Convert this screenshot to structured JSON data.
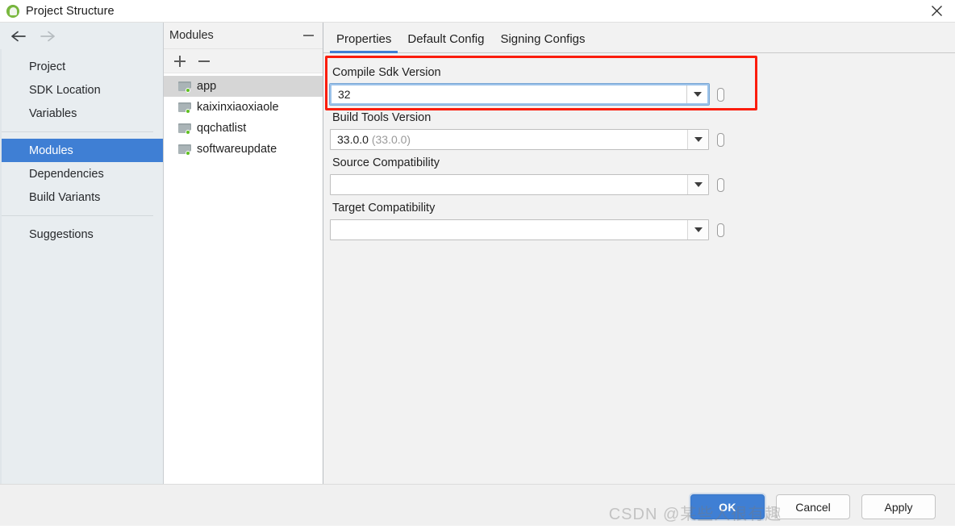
{
  "window": {
    "title": "Project Structure",
    "app_icon": "android-studio-icon",
    "close_icon": "close-icon"
  },
  "left_nav": {
    "back_icon": "arrow-left-icon",
    "forward_icon": "arrow-right-icon",
    "groups": [
      {
        "items": [
          {
            "label": "Project",
            "selected": false
          },
          {
            "label": "SDK Location",
            "selected": false
          },
          {
            "label": "Variables",
            "selected": false
          }
        ]
      },
      {
        "items": [
          {
            "label": "Modules",
            "selected": true
          },
          {
            "label": "Dependencies",
            "selected": false
          },
          {
            "label": "Build Variants",
            "selected": false
          }
        ]
      },
      {
        "items": [
          {
            "label": "Suggestions",
            "selected": false
          }
        ]
      }
    ]
  },
  "modules_panel": {
    "title": "Modules",
    "collapse_icon": "minimize-icon",
    "add_icon": "plus-icon",
    "remove_icon": "minus-icon",
    "items": [
      {
        "label": "app",
        "selected": true
      },
      {
        "label": "kaixinxiaoxiaole",
        "selected": false
      },
      {
        "label": "qqchatlist",
        "selected": false
      },
      {
        "label": "softwareupdate",
        "selected": false
      }
    ]
  },
  "content": {
    "tabs": [
      {
        "label": "Properties",
        "active": true
      },
      {
        "label": "Default Config",
        "active": false
      },
      {
        "label": "Signing Configs",
        "active": false
      }
    ],
    "fields": [
      {
        "label": "Compile Sdk Version",
        "value": "32",
        "hint": "",
        "focused": true,
        "highlighted": true,
        "dropdown_icon": "chevron-down-icon",
        "variable_icon": "variable-binding-icon"
      },
      {
        "label": "Build Tools Version",
        "value": "33.0.0",
        "hint": "(33.0.0)",
        "focused": false,
        "highlighted": false,
        "dropdown_icon": "chevron-down-icon",
        "variable_icon": "variable-binding-icon"
      },
      {
        "label": "Source Compatibility",
        "value": "",
        "hint": "",
        "focused": false,
        "highlighted": false,
        "dropdown_icon": "chevron-down-icon",
        "variable_icon": "variable-binding-icon"
      },
      {
        "label": "Target Compatibility",
        "value": "",
        "hint": "",
        "focused": false,
        "highlighted": false,
        "dropdown_icon": "chevron-down-icon",
        "variable_icon": "variable-binding-icon"
      }
    ]
  },
  "footer": {
    "ok_label": "OK",
    "cancel_label": "Cancel",
    "apply_label": "Apply",
    "watermark": "CSDN @某些人很有趣"
  },
  "colors": {
    "accent_blue": "#3f7fd4",
    "annotation_red": "#fb1d0d",
    "nav_bg": "#e8edf0",
    "module_selected": "#d6d6d6"
  }
}
